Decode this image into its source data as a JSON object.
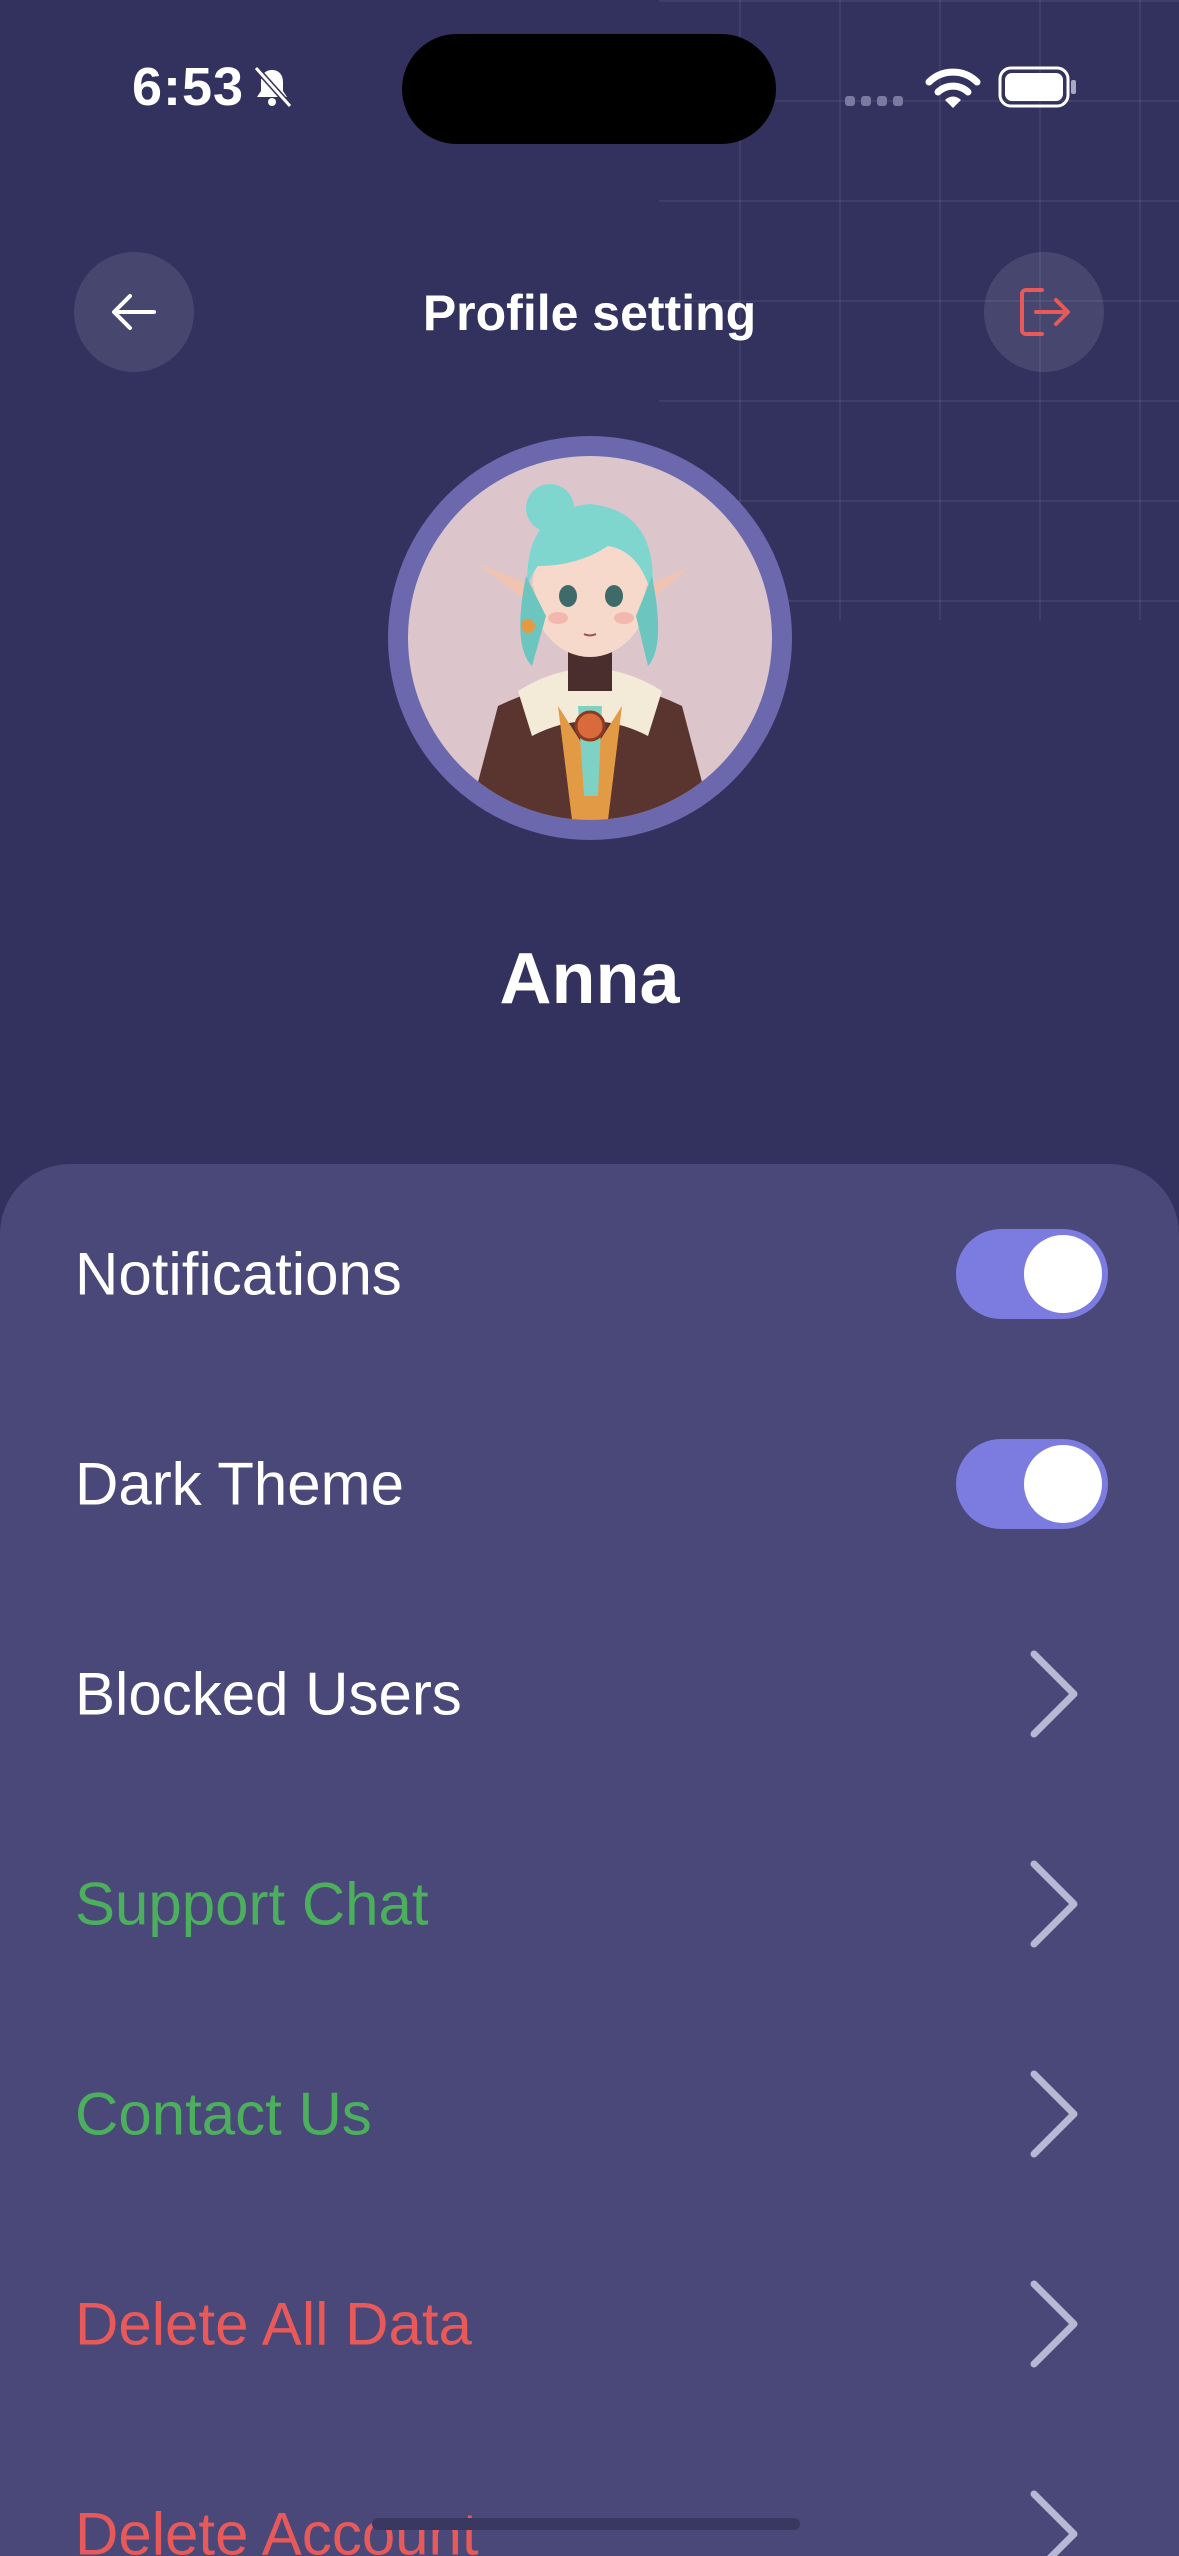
{
  "status": {
    "time": "6:53"
  },
  "header": {
    "title": "Profile setting"
  },
  "profile": {
    "name": "Anna"
  },
  "settings": [
    {
      "label": "Notifications",
      "type": "toggle",
      "on": true
    },
    {
      "label": "Dark Theme",
      "type": "toggle",
      "on": true
    },
    {
      "label": "Blocked Users",
      "type": "link"
    },
    {
      "label": "Support Chat",
      "type": "link"
    },
    {
      "label": "Contact Us",
      "type": "link"
    },
    {
      "label": "Delete All Data",
      "type": "link"
    },
    {
      "label": "Delete Account",
      "type": "link"
    }
  ],
  "colors": {
    "background": "#33325f",
    "sheet": "#4a4878",
    "toggle_on": "#7b7be0",
    "green": "#4caf5e",
    "red": "#e85a5a",
    "chevron": "#b9b8d4"
  }
}
